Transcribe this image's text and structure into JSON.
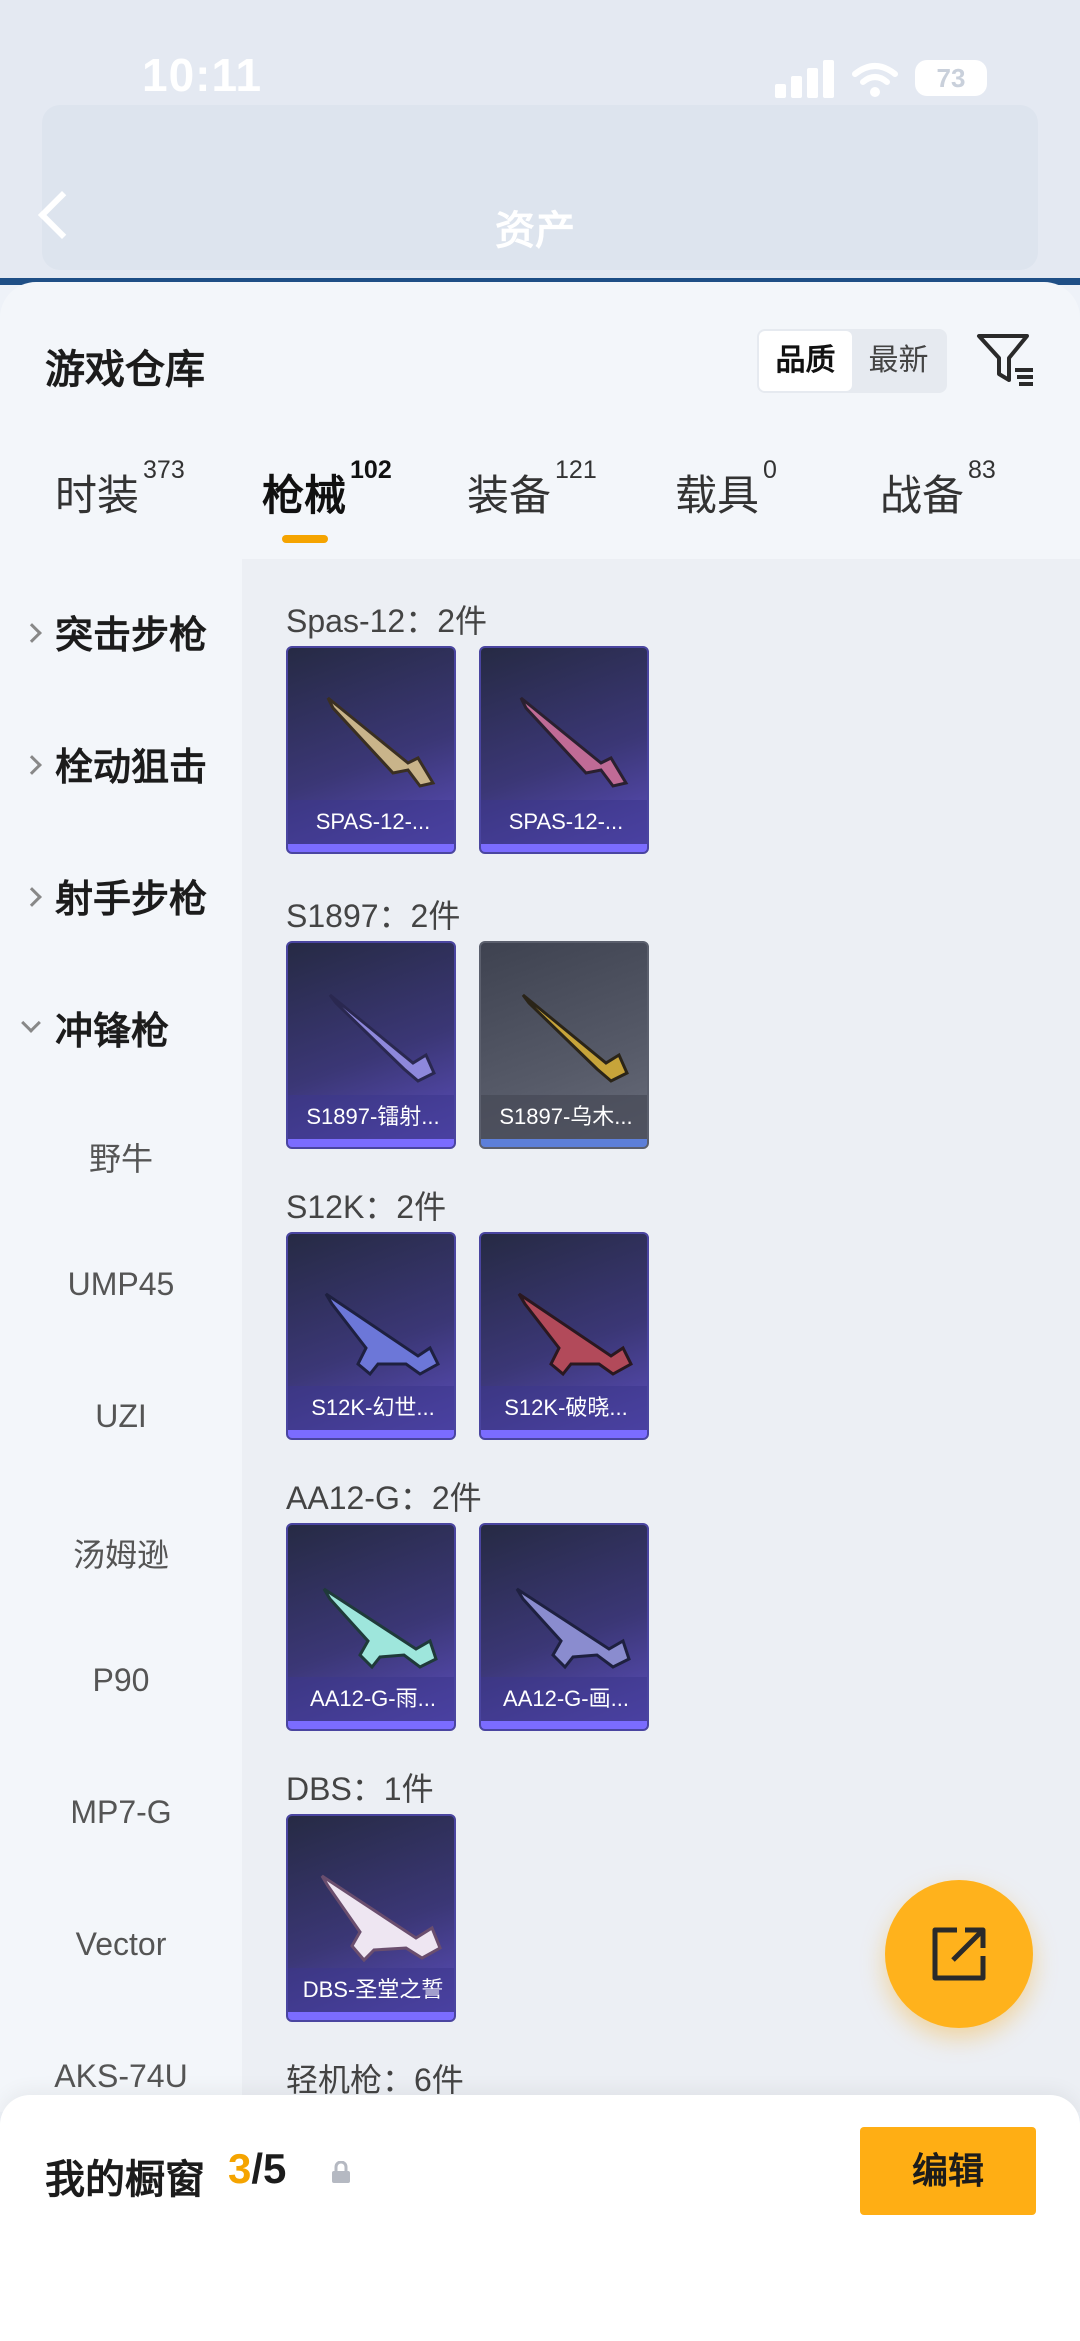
{
  "status_bar": {
    "time": "10:11",
    "battery": "73"
  },
  "header": {
    "title": "资产"
  },
  "sheet": {
    "title": "游戏仓库",
    "sort_options": [
      "品质",
      "最新"
    ],
    "active_sort": "品质"
  },
  "tabs": [
    {
      "label": "时装",
      "count": "373"
    },
    {
      "label": "枪械",
      "count": "102",
      "active": true
    },
    {
      "label": "装备",
      "count": "121"
    },
    {
      "label": "载具",
      "count": "0"
    },
    {
      "label": "战备",
      "count": "83"
    }
  ],
  "categories": [
    {
      "label": "突击步枪",
      "expanded": false
    },
    {
      "label": "栓动狙击",
      "expanded": false
    },
    {
      "label": "射手步枪",
      "expanded": false
    },
    {
      "label": "冲锋枪",
      "expanded": true
    }
  ],
  "sub_items": [
    "野牛",
    "UMP45",
    "UZI",
    "汤姆逊",
    "P90",
    "MP7-G",
    "Vector",
    "AKS-74U"
  ],
  "groups": [
    {
      "title": "Spas-12：2件",
      "items": [
        {
          "name": "SPAS-12-...",
          "rarity": "purple"
        },
        {
          "name": "SPAS-12-...",
          "rarity": "purple"
        }
      ]
    },
    {
      "title": "S1897：2件",
      "items": [
        {
          "name": "S1897-镭射...",
          "rarity": "purple"
        },
        {
          "name": "S1897-乌木...",
          "rarity": "grey"
        }
      ]
    },
    {
      "title": "S12K：2件",
      "items": [
        {
          "name": "S12K-幻世...",
          "rarity": "purple"
        },
        {
          "name": "S12K-破晓...",
          "rarity": "purple"
        }
      ]
    },
    {
      "title": "AA12-G：2件",
      "items": [
        {
          "name": "AA12-G-雨...",
          "rarity": "purple"
        },
        {
          "name": "AA12-G-画...",
          "rarity": "purple"
        }
      ]
    },
    {
      "title": "DBS：1件",
      "items": [
        {
          "name": "DBS-圣堂之誓",
          "rarity": "purple"
        }
      ]
    }
  ],
  "next_group_title": "轻机枪：6件",
  "bottom_bar": {
    "title": "我的橱窗",
    "count_current": "3",
    "count_total": "/5",
    "edit_label": "编辑"
  },
  "colors": {
    "accent": "#f5a400",
    "card_purple": "#3b3776",
    "card_grey": "#565a68"
  }
}
